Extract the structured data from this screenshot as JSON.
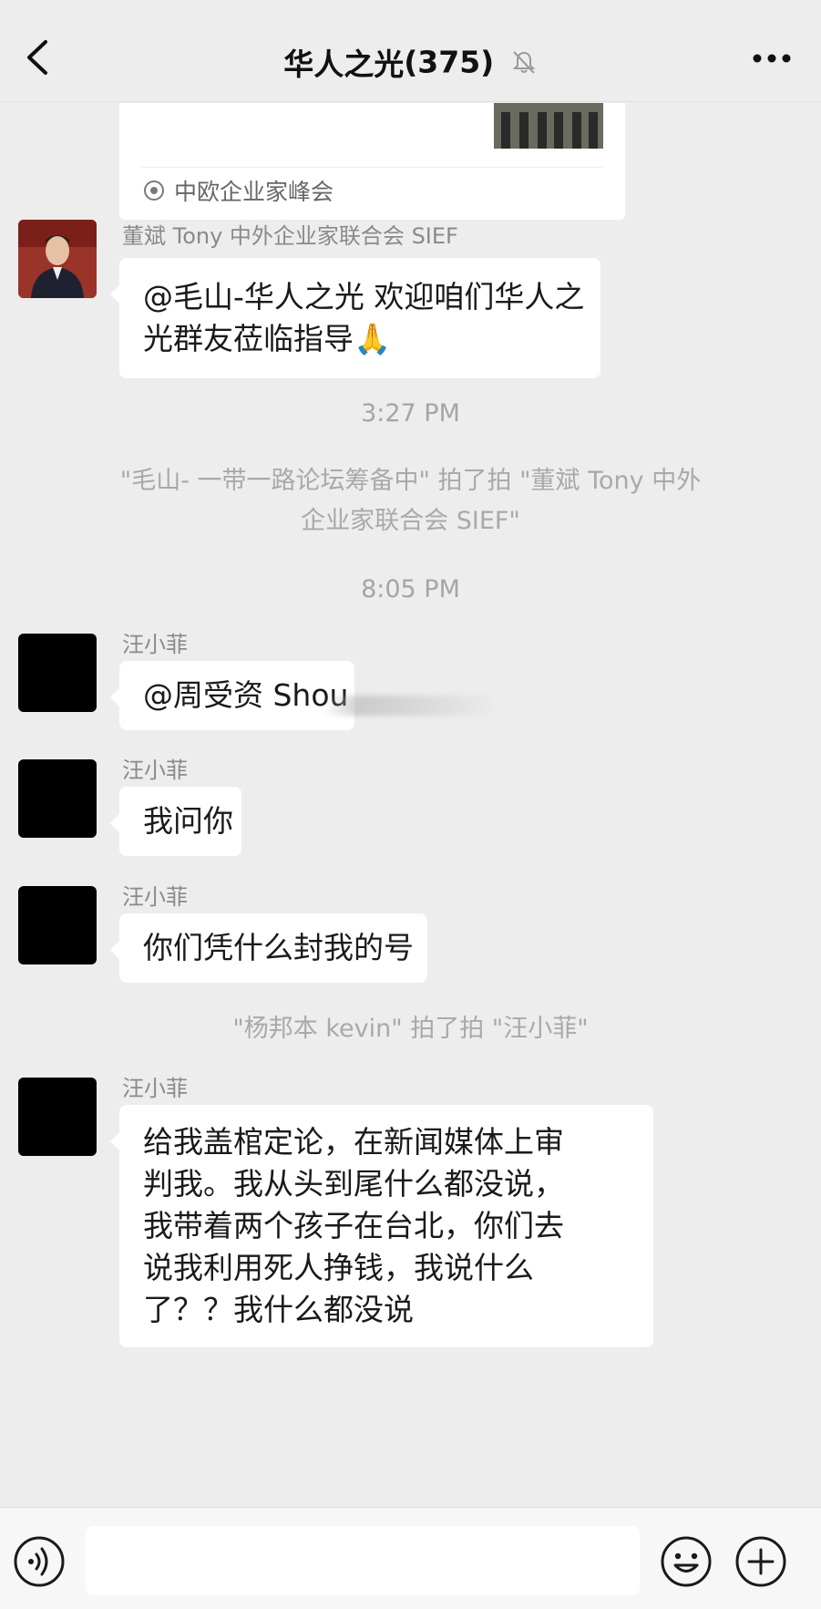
{
  "header": {
    "title": "华人之光",
    "member_count": "(375)",
    "back_icon": "chevron-left-icon",
    "mute_icon": "bell-muted-icon",
    "more_icon": "more-dots-icon"
  },
  "link_card": {
    "source": "中欧企业家峰会"
  },
  "messages": [
    {
      "sender": "董斌 Tony 中外企业家联合会 SIEF",
      "lines": [
        "@毛山-华人之光 欢迎咱们华人之",
        "光群友莅临指导🙏"
      ]
    },
    {
      "sender": "汪小菲",
      "lines": [
        "@周受资 Shou"
      ]
    },
    {
      "sender": "汪小菲",
      "lines": [
        "我问你"
      ]
    },
    {
      "sender": "汪小菲",
      "lines": [
        "你们凭什么封我的号"
      ]
    },
    {
      "sender": "汪小菲",
      "lines": [
        "给我盖棺定论，在新闻媒体上审",
        "判我。我从头到尾什么都没说，",
        "我带着两个孩子在台北，你们去",
        "说我利用死人挣钱，我说什么",
        "了？？我什么都没说"
      ]
    }
  ],
  "timestamps": [
    "3:27 PM",
    "8:05 PM"
  ],
  "system_messages": [
    {
      "lines": [
        "\"毛山- 一带一路论坛筹备中\" 拍了拍 \"董斌 Tony 中外",
        "企业家联合会 SIEF\""
      ]
    },
    {
      "lines": [
        "\"杨邦本 kevin\" 拍了拍 \"汪小菲\""
      ]
    }
  ],
  "input_bar": {
    "voice_icon": "voice-icon",
    "emoji_icon": "emoji-icon",
    "plus_icon": "plus-circle-icon",
    "text_value": ""
  },
  "colors": {
    "background": "#ededed",
    "bubble": "#ffffff",
    "system_text": "#a9a9a9",
    "sender_text": "#8a8a8a"
  }
}
